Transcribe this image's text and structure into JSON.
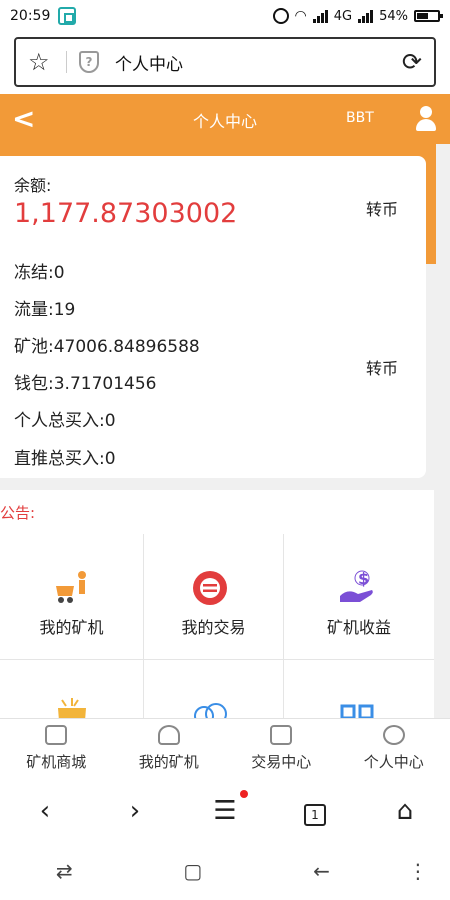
{
  "status_bar": {
    "time": "20:59",
    "network": "4G",
    "battery": "54%"
  },
  "url_bar": {
    "title": "个人中心"
  },
  "header": {
    "title": "个人中心",
    "right_text": "BBT"
  },
  "balance": {
    "label": "余额:",
    "amount": "1,177.87303002",
    "transfer1": "转币",
    "transfer2": "转币",
    "rows": [
      "冻结:0",
      "流量:19",
      "矿池:47006.84896588",
      "钱包:3.71701456",
      "个人总买入:0",
      "直推总买入:0"
    ]
  },
  "notice": {
    "label": "公告:"
  },
  "grid": {
    "items": [
      {
        "label": "我的矿机"
      },
      {
        "label": "我的交易"
      },
      {
        "label": "矿机收益"
      }
    ]
  },
  "app_nav": {
    "items": [
      {
        "label": "矿机商城"
      },
      {
        "label": "我的矿机"
      },
      {
        "label": "交易中心"
      },
      {
        "label": "个人中心"
      }
    ]
  },
  "browser_nav": {
    "tab_count": "1"
  },
  "colors": {
    "accent": "#f29a38",
    "amount": "#e23d3d"
  }
}
